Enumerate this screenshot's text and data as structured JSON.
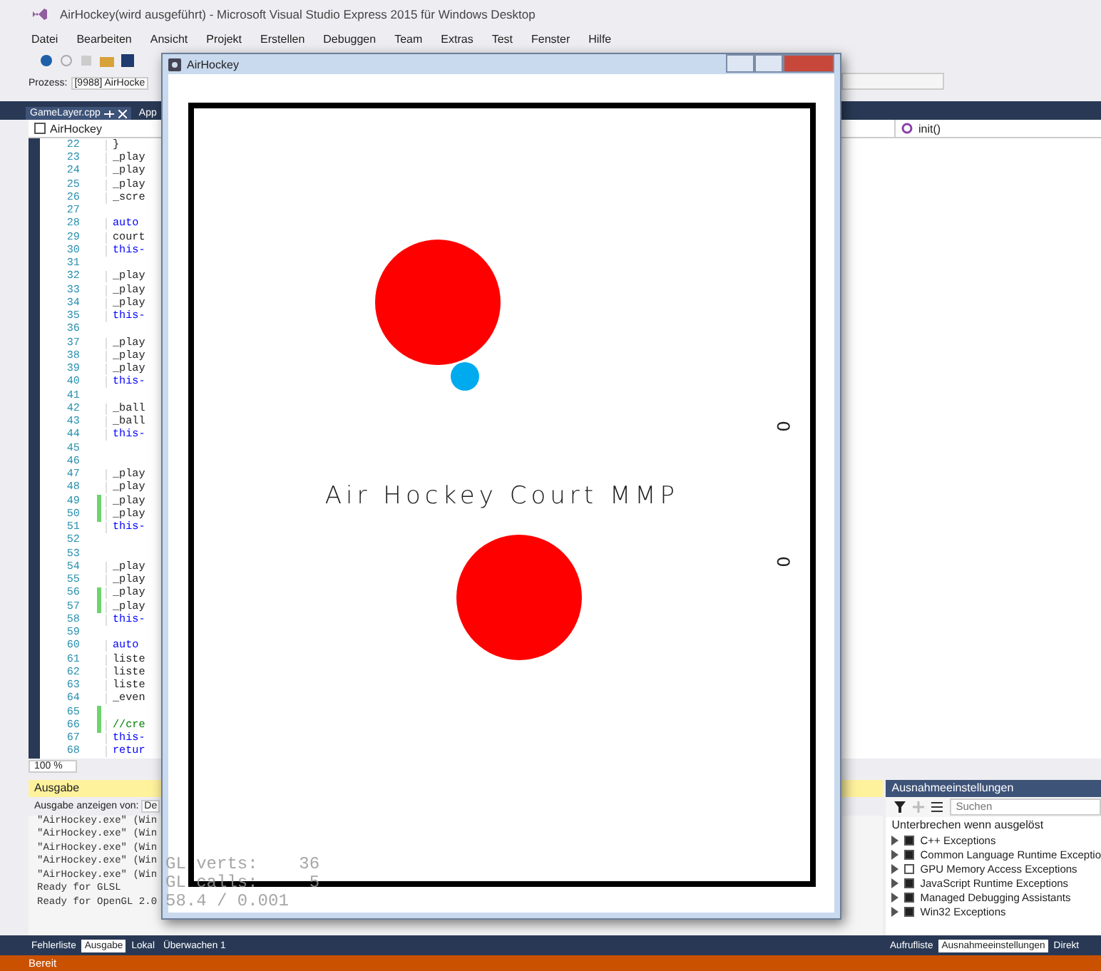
{
  "window": {
    "title": "AirHockey(wird ausgeführt) - Microsoft Visual Studio Express 2015 für Windows Desktop"
  },
  "menu": [
    "Datei",
    "Bearbeiten",
    "Ansicht",
    "Projekt",
    "Erstellen",
    "Debuggen",
    "Team",
    "Extras",
    "Test",
    "Fenster",
    "Hilfe"
  ],
  "toolbar": {
    "process_label": "Prozess:",
    "process_value": "[9988] AirHocke"
  },
  "editor": {
    "tabs": [
      {
        "label": "GameLayer.cpp",
        "selected": true
      },
      {
        "label": "App",
        "selected": false
      }
    ],
    "scope": "AirHockey",
    "member": "init()",
    "zoom": "100 %",
    "lines": [
      {
        "number": "22",
        "code": "}",
        "kind": "plain",
        "changed": false
      },
      {
        "number": "23",
        "code": "_play",
        "kind": "plain",
        "changed": false
      },
      {
        "number": "24",
        "code": "_play",
        "kind": "plain",
        "changed": false
      },
      {
        "number": "25",
        "code": "_play",
        "kind": "plain",
        "changed": false
      },
      {
        "number": "26",
        "code": "_scre",
        "kind": "plain",
        "changed": false
      },
      {
        "number": "27",
        "kind": "plain",
        "changed": false
      },
      {
        "number": "28",
        "code": "auto",
        "kind": "keyword",
        "changed": false
      },
      {
        "number": "29",
        "code": "court",
        "kind": "plain",
        "changed": false
      },
      {
        "number": "30",
        "code": "this-",
        "kind": "keyword",
        "changed": false
      },
      {
        "number": "31",
        "kind": "plain",
        "changed": false
      },
      {
        "number": "32",
        "code": "_play",
        "kind": "plain",
        "changed": false
      },
      {
        "number": "33",
        "code": "_play",
        "kind": "plain",
        "changed": false
      },
      {
        "number": "34",
        "code": "_play",
        "kind": "plain",
        "changed": false
      },
      {
        "number": "35",
        "code": "this-",
        "kind": "keyword",
        "changed": false
      },
      {
        "number": "36",
        "kind": "plain",
        "changed": false
      },
      {
        "number": "37",
        "code": "_play",
        "kind": "plain",
        "changed": false
      },
      {
        "number": "38",
        "code": "_play",
        "kind": "plain",
        "changed": false
      },
      {
        "number": "39",
        "code": "_play",
        "kind": "plain",
        "changed": false
      },
      {
        "number": "40",
        "code": "this-",
        "kind": "keyword",
        "changed": false
      },
      {
        "number": "41",
        "kind": "plain",
        "changed": false
      },
      {
        "number": "42",
        "code": "_ball",
        "kind": "plain",
        "changed": false
      },
      {
        "number": "43",
        "code": "_ball",
        "kind": "plain",
        "changed": false
      },
      {
        "number": "44",
        "code": "this-",
        "kind": "keyword",
        "changed": false
      },
      {
        "number": "45",
        "kind": "plain",
        "changed": false
      },
      {
        "number": "46",
        "kind": "plain",
        "changed": false
      },
      {
        "number": "47",
        "code": "_play",
        "kind": "plain",
        "changed": false
      },
      {
        "number": "48",
        "code": "_play",
        "kind": "plain",
        "changed": false
      },
      {
        "number": "49",
        "code": "_play",
        "kind": "plain",
        "changed": true
      },
      {
        "number": "50",
        "code": "_play",
        "kind": "plain",
        "changed": true
      },
      {
        "number": "51",
        "code": "this-",
        "kind": "keyword",
        "changed": false
      },
      {
        "number": "52",
        "kind": "plain",
        "changed": false
      },
      {
        "number": "53",
        "kind": "plain",
        "changed": false
      },
      {
        "number": "54",
        "code": "_play",
        "kind": "plain",
        "changed": false
      },
      {
        "number": "55",
        "code": "_play",
        "kind": "plain",
        "changed": false
      },
      {
        "number": "56",
        "code": "_play",
        "kind": "plain",
        "changed": true
      },
      {
        "number": "57",
        "code": "_play",
        "kind": "plain",
        "changed": true
      },
      {
        "number": "58",
        "code": "this-",
        "kind": "keyword",
        "changed": false
      },
      {
        "number": "59",
        "kind": "plain",
        "changed": false
      },
      {
        "number": "60",
        "code": "auto",
        "kind": "keyword",
        "changed": false
      },
      {
        "number": "61",
        "code": "liste",
        "kind": "plain",
        "changed": false
      },
      {
        "number": "62",
        "code": "liste",
        "kind": "plain",
        "changed": false
      },
      {
        "number": "63",
        "code": "liste",
        "kind": "plain",
        "changed": false
      },
      {
        "number": "64",
        "code": "_even",
        "kind": "plain",
        "changed": false
      },
      {
        "number": "65",
        "kind": "plain",
        "changed": true
      },
      {
        "number": "66",
        "code": "//cre",
        "kind": "comment",
        "changed": true
      },
      {
        "number": "67",
        "code": "this-",
        "kind": "keyword",
        "changed": false
      },
      {
        "number": "68",
        "code": "retur",
        "kind": "keyword",
        "changed": false
      }
    ]
  },
  "output": {
    "title": "Ausgabe",
    "source_label": "Ausgabe anzeigen von:",
    "source_value": "De",
    "lines": [
      "\"AirHockey.exe\" (Win",
      "\"AirHockey.exe\" (Win",
      "\"AirHockey.exe\" (Win",
      "\"AirHockey.exe\" (Win",
      "\"AirHockey.exe\" (Win",
      "Ready for GLSL",
      "Ready for OpenGL 2.0"
    ]
  },
  "exceptions": {
    "title": "Ausnahmeeinstellungen",
    "search_placeholder": "Suchen",
    "column": "Unterbrechen wenn ausgelöst",
    "items": [
      {
        "label": "C++ Exceptions",
        "checked": true
      },
      {
        "label": "Common Language Runtime Exceptio",
        "checked": true
      },
      {
        "label": "GPU Memory Access Exceptions",
        "checked": false
      },
      {
        "label": "JavaScript Runtime Exceptions",
        "checked": true
      },
      {
        "label": "Managed Debugging Assistants",
        "checked": true
      },
      {
        "label": "Win32 Exceptions",
        "checked": true
      }
    ]
  },
  "bottom_tabs_left": [
    {
      "label": "Fehlerliste",
      "selected": false
    },
    {
      "label": "Ausgabe",
      "selected": true
    },
    {
      "label": "Lokal",
      "selected": false
    },
    {
      "label": "Überwachen 1",
      "selected": false
    }
  ],
  "bottom_tabs_right": [
    {
      "label": "Aufrufliste",
      "selected": false
    },
    {
      "label": "Ausnahmeeinstellungen",
      "selected": true
    },
    {
      "label": "Direkt",
      "selected": false
    }
  ],
  "status_bar": "Bereit",
  "game": {
    "title": "AirHockey",
    "court_label": "Air Hockey Court MMP",
    "scores": [
      "0",
      "0"
    ],
    "stats": [
      "GL verts:    36",
      "GL calls:     5",
      "58.4 / 0.001"
    ]
  }
}
